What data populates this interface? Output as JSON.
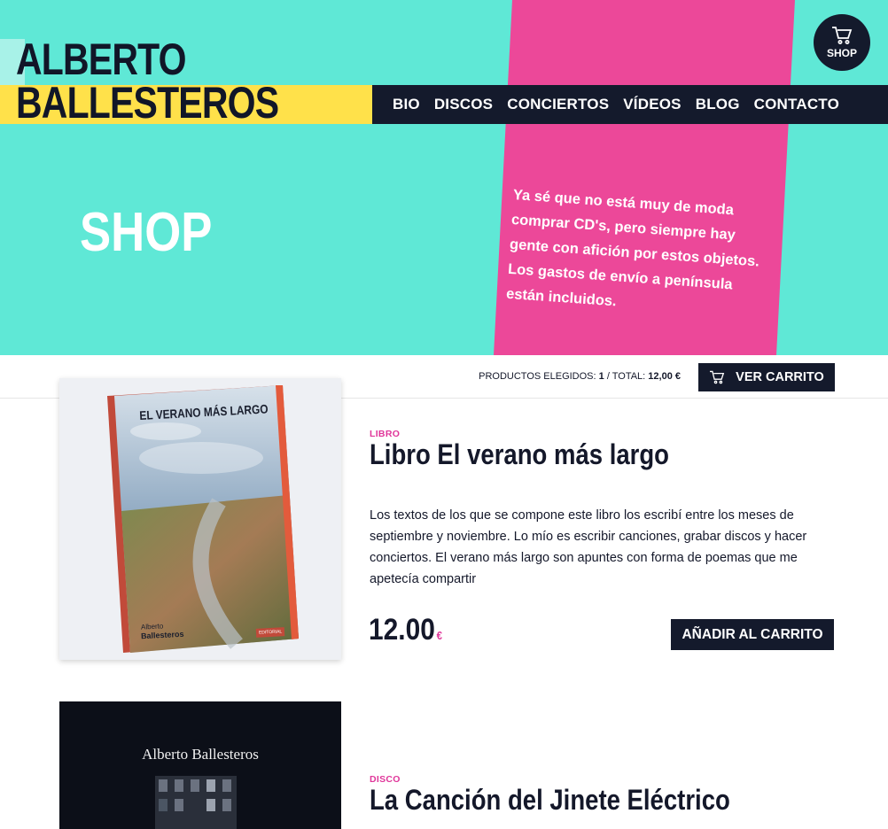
{
  "brand": {
    "line1": "ALBERTO",
    "line2": "BALLESTEROS"
  },
  "nav": {
    "items": [
      "BIO",
      "DISCOS",
      "CONCIERTOS",
      "VÍDEOS",
      "BLOG",
      "CONTACTO"
    ]
  },
  "shop_button": {
    "label": "SHOP",
    "icon": "cart-icon"
  },
  "hero": {
    "title": "SHOP",
    "text": "Ya sé que no está muy de moda comprar CD's, pero siempre hay gente con afición por estos objetos. Los gastos de envío a península están incluidos."
  },
  "cart_bar": {
    "label": "PRODUCTOS ELEGIDOS:",
    "count": "1",
    "sep": "/ TOTAL:",
    "total": "12,00 €",
    "button": "VER CARRITO"
  },
  "products": [
    {
      "category": "LIBRO",
      "title": "Libro El verano más largo",
      "description": "Los textos de los que se compone este libro los escribí entre los meses de septiembre y noviembre. Lo mío es escribir canciones, grabar discos y hacer conciertos. El verano más largo son apuntes con forma de poemas que me apetecía compartir",
      "price": "12.00",
      "currency": "€",
      "button": "AÑADIR AL CARRITO",
      "cover": {
        "title": "EL VERANO MÁS LARGO",
        "author_line1": "Alberto",
        "author_line2": "Ballesteros",
        "publisher": "EDITORIAL"
      }
    },
    {
      "category": "DISCO",
      "title": "La Canción del Jinete Eléctrico",
      "cover": {
        "artist": "Alberto Ballesteros"
      }
    }
  ],
  "colors": {
    "teal": "#5fe8d6",
    "pink": "#ec4899",
    "navy": "#141a2c",
    "yellow": "#ffe14a",
    "accent": "#e0369a"
  }
}
